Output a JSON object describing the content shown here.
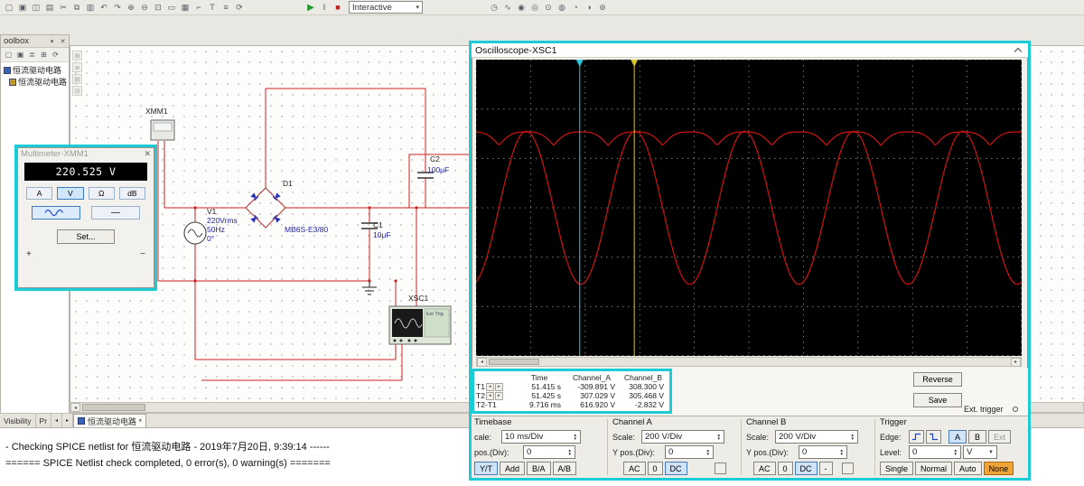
{
  "colors": {
    "highlight": "#1bccd6",
    "wire": "#cc2222",
    "component_value": "#2323a8",
    "trace": "#d01313",
    "cursor1": "#2ac8dc",
    "cursor2": "#d8c428",
    "selected_button": "#cfe3f8",
    "none_button": "#f0a438"
  },
  "toolbar": {
    "left_icons": [
      {
        "name": "new-file",
        "glyph": "▢"
      },
      {
        "name": "open-file",
        "glyph": "▣"
      },
      {
        "name": "save",
        "glyph": "◫"
      },
      {
        "name": "print",
        "glyph": "▤"
      },
      {
        "name": "cut",
        "glyph": "✂"
      },
      {
        "name": "copy",
        "glyph": "⧉"
      },
      {
        "name": "paste",
        "glyph": "▥"
      },
      {
        "name": "undo",
        "glyph": "↶"
      },
      {
        "name": "redo",
        "glyph": "↷"
      },
      {
        "name": "zoom-in",
        "glyph": "⊕"
      },
      {
        "name": "zoom-out",
        "glyph": "⊖"
      },
      {
        "name": "zoom-area",
        "glyph": "⊡"
      },
      {
        "name": "zoom-fit",
        "glyph": "▭"
      },
      {
        "name": "grid-toggle",
        "glyph": "▦"
      },
      {
        "name": "place-wire",
        "glyph": "⌐"
      },
      {
        "name": "place-text",
        "glyph": "T"
      },
      {
        "name": "place-component",
        "glyph": "≡"
      },
      {
        "name": "rotate",
        "glyph": "⟳"
      }
    ],
    "sim": {
      "run_glyph": "▶",
      "pause_glyph": "‖",
      "stop_glyph": "■"
    },
    "interactive_label": "Interactive",
    "dropdown_arrow": "▾",
    "right_icons": [
      {
        "name": "multimeter-instrument",
        "glyph": "◷"
      },
      {
        "name": "function-generator",
        "glyph": "∿"
      },
      {
        "name": "wattmeter",
        "glyph": "◉"
      },
      {
        "name": "oscilloscope-instrument",
        "glyph": "◎"
      },
      {
        "name": "bode-plotter",
        "glyph": "⊙"
      },
      {
        "name": "frequency-counter",
        "glyph": "◍"
      },
      {
        "name": "distortion-analyzer",
        "glyph": "◔"
      },
      {
        "name": "spectrum-analyzer",
        "glyph": "◑"
      },
      {
        "name": "logic-analyzer",
        "glyph": "⊚"
      }
    ]
  },
  "toolbox": {
    "title": "oolbox",
    "collapse_glyph": "▾",
    "close_glyph": "✕",
    "mini_icons": [
      {
        "name": "new-schematic",
        "glyph": "▢"
      },
      {
        "name": "open-design",
        "glyph": "▣"
      },
      {
        "name": "hierarchy-view",
        "glyph": "≣"
      },
      {
        "name": "expand-tree",
        "glyph": "⊞"
      },
      {
        "name": "refresh-tree",
        "glyph": "⟳"
      }
    ],
    "tree": [
      {
        "label": "恒流驱动电路"
      },
      {
        "label": "恒流驱动电路"
      }
    ]
  },
  "circuit": {
    "xmm1_label": "XMM1",
    "v1_name": "V1",
    "v1_value1": "220Vrms",
    "v1_value2": "50Hz",
    "v1_value3": "0°",
    "d1_name": "D1",
    "d1_model": "MB6S-E3/80",
    "c1_name": "C1",
    "c1_value": "10μF",
    "c2_name": "C2",
    "c2_value": "100μF",
    "xsc1_label": "XSC1",
    "xsc1_ext_trig": "Ext Trig"
  },
  "multimeter": {
    "title": "Multimeter-XMM1",
    "close_glyph": "✕",
    "reading": "220.525 V",
    "mode_buttons": [
      "A",
      "V",
      "Ω",
      "dB"
    ],
    "selected_mode": "V",
    "line_mode_glyph": "—",
    "set_button": "Set...",
    "plus_terminal": "+",
    "minus_terminal": "−"
  },
  "oscilloscope": {
    "title": "Oscilloscope-XSC1",
    "measurements": {
      "headers": [
        "Time",
        "Channel_A",
        "Channel_B"
      ],
      "rows": [
        {
          "label": "T1",
          "time": "51.415 s",
          "channel_a": "-309.891 V",
          "channel_b": "308.300 V"
        },
        {
          "label": "T2",
          "time": "51.425 s",
          "channel_a": "307.029 V",
          "channel_b": "305.468 V"
        },
        {
          "label": "T2-T1",
          "time": "9.716 ms",
          "channel_a": "616.920 V",
          "channel_b": "-2.832 V"
        }
      ]
    },
    "reverse_button": "Reverse",
    "save_button": "Save",
    "ext_trigger_label": "Ext. trigger",
    "timebase": {
      "title": "Timebase",
      "scale_label": "cale:",
      "scale_value": "10 ms/Div",
      "xpos_label": "pos.(Div):",
      "xpos_value": "0",
      "buttons": [
        "Y/T",
        "Add",
        "B/A",
        "A/B"
      ],
      "selected": "Y/T"
    },
    "channel_a": {
      "title": "Channel A",
      "scale_label": "Scale:",
      "scale_value": "200  V/Div",
      "ypos_label": "Y pos.(Div):",
      "ypos_value": "0",
      "buttons": [
        "AC",
        "0",
        "DC"
      ],
      "selected": "DC"
    },
    "channel_b": {
      "title": "Channel B",
      "scale_label": "Scale:",
      "scale_value": "200  V/Div",
      "ypos_label": "Y pos.(Div):",
      "ypos_value": "0",
      "buttons": [
        "AC",
        "0",
        "DC",
        "-"
      ],
      "selected": "DC"
    },
    "trigger": {
      "title": "Trigger",
      "edge_label": "Edge:",
      "source_buttons": [
        "A",
        "B",
        "Ext"
      ],
      "selected_source": "A",
      "level_label": "Level:",
      "level_value": "0",
      "level_unit": "V",
      "mode_buttons": [
        "Single",
        "Normal",
        "Auto",
        "None"
      ],
      "selected_mode": "None"
    },
    "waveform": {
      "volts_per_div": 200,
      "ms_per_div": 10,
      "cols": 10,
      "rows": 6,
      "channel_a": {
        "amplitude_v": 310,
        "frequency_hz": 50
      },
      "channel_b": {
        "level_v": 307,
        "ripple_v": 55
      },
      "phase_div": 2.42,
      "cursors": {
        "t1_div": 1.9,
        "t2_div": 2.9
      }
    }
  },
  "statusbar": {
    "line1": "- Checking SPICE netlist for 恒流驱动电路 - 2019年7月20日, 9:39:14 ------",
    "line2": "====== SPICE Netlist check completed, 0 error(s), 0 warning(s) ======="
  },
  "tabbar": {
    "visibility": "Visibility",
    "project": "Pr",
    "prev_glyph": "◂",
    "next_glyph": "▸",
    "sheet": "恒流驱动电路 *"
  }
}
